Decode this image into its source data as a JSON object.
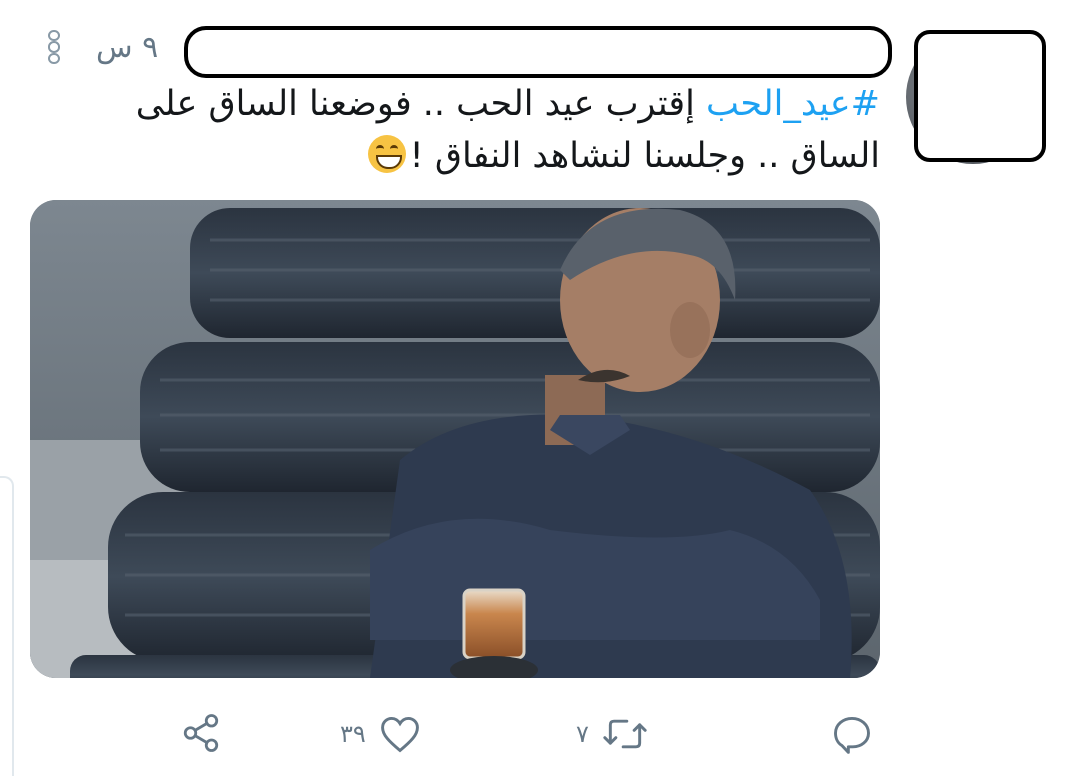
{
  "tweet": {
    "timestamp": "٩ س",
    "text": {
      "hashtag": "#عيد_الحب",
      "body": " إقترب عيد الحب .. فوضعنا الساق على الساق .. وجلسنا لنشاهد النفاق !"
    },
    "emoji": "grinning-face-with-smiling-eyes",
    "media": {
      "description_icon": "photo"
    },
    "actions": {
      "reply": {
        "icon": "reply-icon"
      },
      "retweet": {
        "icon": "retweet-icon",
        "count": "٧"
      },
      "like": {
        "icon": "heart-icon",
        "count": "٣٩"
      },
      "share": {
        "icon": "share-icon"
      }
    }
  },
  "colors": {
    "accent": "#1da1f2",
    "text": "#14171a",
    "secondary": "#657786",
    "redaction": "#000000"
  }
}
